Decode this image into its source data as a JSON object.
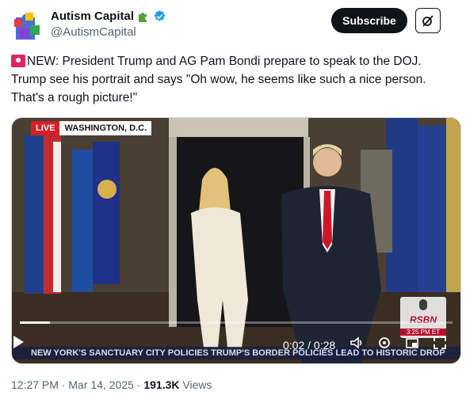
{
  "author": {
    "name": "Autism Capital",
    "handle": "@AutismCapital",
    "badge_icon": "puzzle-piece-green-icon",
    "verified_icon": "verified-badge-icon"
  },
  "actions": {
    "subscribe_label": "Subscribe",
    "grok_icon": "grok-icon"
  },
  "tweet": {
    "line1": "NEW: President Trump and AG Pam Bondi prepare to speak to the DOJ.",
    "line2": "Trump see his portrait and says \"Oh wow, he seems like such a nice person.",
    "line3": "That's a rough picture!\""
  },
  "video": {
    "live_label": "LIVE",
    "location": "WASHINGTON, D.C.",
    "time_display": "0:02 / 0:28",
    "progress": 0.07,
    "ticker": "NEW YORK'S SANCTUARY CITY POLICIES    TRUMP'S BORDER POLICIES LEAD TO HISTORIC DROP",
    "watermark": "RSBN",
    "watermark_time": "3:25 PM ET"
  },
  "meta": {
    "time": "12:27 PM",
    "date": "Mar 14, 2025",
    "views_count": "191.3K",
    "views_label": "Views"
  }
}
